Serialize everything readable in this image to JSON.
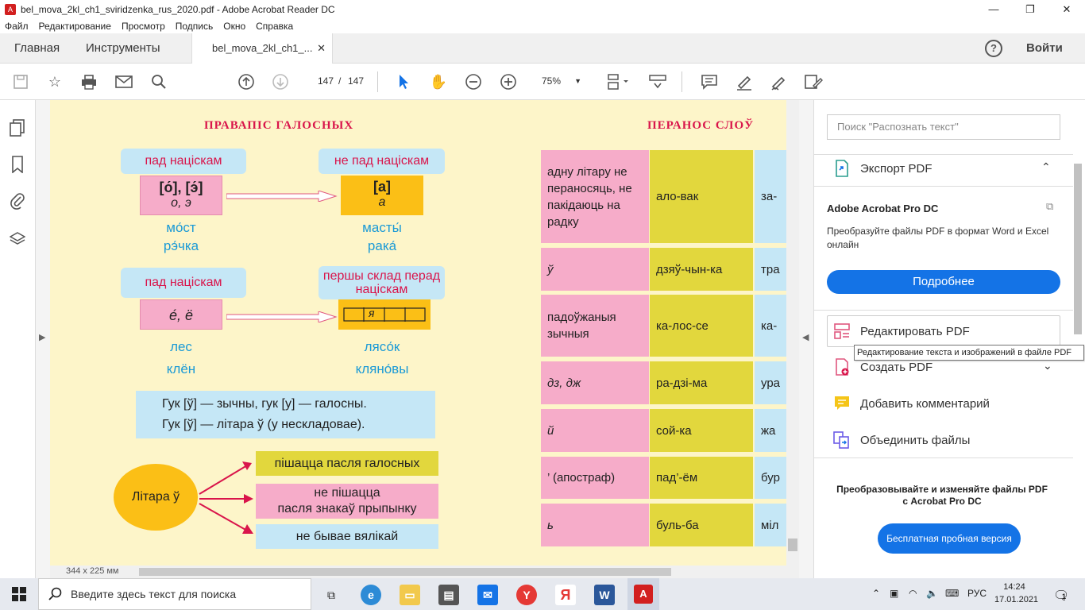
{
  "window": {
    "title": "bel_mova_2kl_ch1_sviridzenka_rus_2020.pdf - Adobe Acrobat Reader DC",
    "minimize": "—",
    "maximize": "❐",
    "close": "✕"
  },
  "menu": [
    "Файл",
    "Редактирование",
    "Просмотр",
    "Подпись",
    "Окно",
    "Справка"
  ],
  "tabs": {
    "home": "Главная",
    "tools": "Инструменты",
    "doc": "bel_mova_2kl_ch1_...",
    "doc_close": "✕",
    "help": "?",
    "signin": "Войти"
  },
  "toolbar": {
    "page_current": "147",
    "page_sep": "/",
    "page_total": "147",
    "zoom": "75%"
  },
  "page": {
    "heading_left": "ПРАВАПІС ГАЛОСНЫХ",
    "heading_right": "ПЕРАНОС СЛОЎ",
    "lbl1": "пад націскам",
    "lbl2": "не пад націскам",
    "lbl3": "пад націскам",
    "lbl4": "першы склад перад націскам",
    "box1_top": "[о́], [э́]",
    "box1_bot": "о, э",
    "box2_top": "[а]",
    "box2_bot": "а",
    "box3": "е́, ё",
    "box4": "я",
    "w1": "мо́ст",
    "w2": "рэ́чка",
    "w3": "масты́",
    "w4": "рака́",
    "w5": "лес",
    "w6": "клён",
    "w7": "лясо́к",
    "w8": "кляно́вы",
    "rule1": "Гук [ў] — зычны, гук [у] — галосны.",
    "rule2": "Гук [ў] — літара ў (у нескладовае).",
    "letter": "Літара ў",
    "out1": "пішацца пасля галосных",
    "out2a": "не пішацца",
    "out2b": "пасля знакаў прыпынку",
    "out3": "не бывае вялікай",
    "table": [
      {
        "rule": "адну літару не пераносяць, не пакідаюць на радку",
        "ex1": "ало-вак",
        "ex2": "за-"
      },
      {
        "rule": "ў",
        "ex1": "дзяў-чын-ка",
        "ex2": "тра"
      },
      {
        "rule": "падоўжаныя зычныя",
        "ex1": "ка-лос-се",
        "ex2": "ка-"
      },
      {
        "rule": "дз, дж",
        "ex1": "ра-дзі-ма",
        "ex2": "ура"
      },
      {
        "rule": "й",
        "ex1": "сой-ка",
        "ex2": "жа"
      },
      {
        "rule": "’ (апостраф)",
        "ex1": "пад’-ём",
        "ex2": "бур"
      },
      {
        "rule": "ь",
        "ex1": "буль-ба",
        "ex2": "міл"
      }
    ]
  },
  "status": {
    "page_size": "344 x 225 мм"
  },
  "rightpanel": {
    "search_placeholder": "Поиск \"Распознать текст\"",
    "export": "Экспорт PDF",
    "pro_title": "Adobe Acrobat Pro DC",
    "pro_desc": "Преобразуйте файлы PDF в формат Word и Excel онлайн",
    "more_btn": "Подробнее",
    "edit": "Редактировать PDF",
    "tooltip": "Редактирование текста и изображений в файле PDF",
    "create": "Создать PDF",
    "comment": "Добавить комментарий",
    "combine": "Объединить файлы",
    "promo": "Преобразовывайте и изменяйте файлы PDF с Acrobat Pro DC",
    "trial_btn": "Бесплатная пробная версия"
  },
  "taskbar": {
    "search": "Введите здесь текст для поиска",
    "lang": "РУС",
    "time": "14:24",
    "date": "17.01.2021",
    "notif": "1"
  }
}
